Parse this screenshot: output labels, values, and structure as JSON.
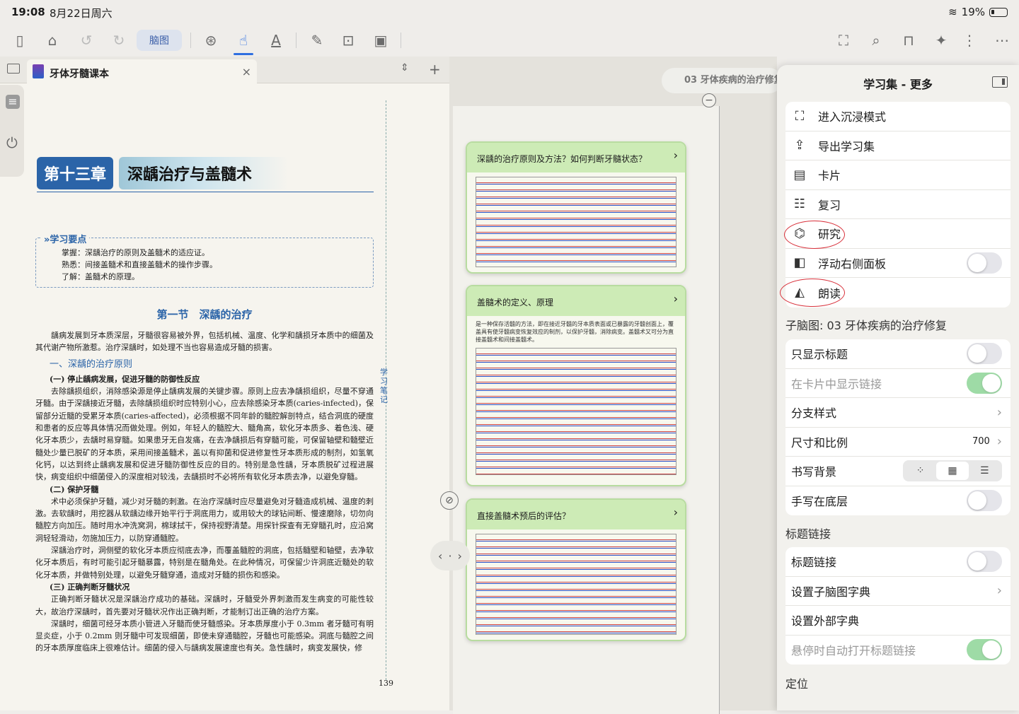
{
  "status": {
    "time": "19:08",
    "date": "8月22日周六",
    "battery": "19%"
  },
  "toolbar": {
    "mindmap_label": "脑图"
  },
  "left": {
    "tab_title": "牙体牙髓课本",
    "chapter_no": "第十三章",
    "chapter_title": "深龋治疗与盖髓术",
    "kp_title": "学习要点",
    "kp_lines": [
      "掌握：深龋治疗的原则及盖髓术的适应证。",
      "熟悉：间接盖髓术和直接盖髓术的操作步骤。",
      "了解：盖髓术的原理。"
    ],
    "section_title": "第一节　深龋的治疗",
    "intro": "龋病发展到牙本质深层，牙髓很容易被外界，包括机械、温度、化学和龋损牙本质中的细菌及其代谢产物所激惹。治疗深龋时，如处理不当也容易造成牙髓的损害。",
    "h1": "一、深龋的治疗原则",
    "h2a": "(一) 停止龋病发展，促进牙髓的防御性反应",
    "p1": "去除龋损组织，消除感染源是停止龋病发展的关键步骤。原则上应去净龋损组织，尽量不穿通牙髓。由于深龋接近牙髓，去除龋损组织时应特别小心，应去除感染牙本质(caries-infected)，保留部分近髓的受累牙本质(caries-affected)，必须根据不同年龄的髓腔解剖特点，结合洞底的硬度和患者的反应等具体情况而做处理。例如，年轻人的髓腔大、髓角高，软化牙本质多、着色浅、硬化牙本质少，去龋时易穿髓。如果患牙无自发痛，在去净龋损后有穿髓可能，可保留轴壁和髓壁近髓处少量已脱矿的牙本质，采用间接盖髓术，盖以有抑菌和促进修复性牙本质形成的制剂，如氢氧化钙，以达到终止龋病发展和促进牙髓防御性反应的目的。特别是急性龋，牙本质脱矿过程进展快，病变组织中细菌侵入的深度相对较浅，去龋损时不必将所有软化牙本质去净，以避免穿髓。",
    "h2b": "(二) 保护牙髓",
    "p2": "术中必须保护牙髓，减少对牙髓的刺激。在治疗深龋时应尽量避免对牙髓造成机械、温度的刺激。去软龋时，用挖器从软龋边缘开始平行于洞底用力，或用较大的球钻间断、慢速磨除，切勿向髓腔方向加压。随时用水冲洗窝洞，棉球拭干，保持视野清楚。用探针探查有无穿髓孔时，应沿窝洞轻轻滑动，勿施加压力，以防穿通髓腔。",
    "p3": "深龋治疗时，洞侧壁的软化牙本质应彻底去净，而覆盖髓腔的洞底，包括髓壁和轴壁，去净软化牙本质后，有时可能引起牙髓暴露，特别是在髓角处。在此种情况，可保留少许洞底近髓处的软化牙本质，并做特别处理，以避免牙髓穿通，造成对牙髓的损伤和感染。",
    "h2c": "(三) 正确判断牙髓状况",
    "p4": "正确判断牙髓状况是深龋治疗成功的基础。深龋时，牙髓受外界刺激而发生病变的可能性较大，故治疗深龋时，首先要对牙髓状况作出正确判断，才能制订出正确的治疗方案。",
    "p5": "深龋时，细菌可经牙本质小管进入牙髓而使牙髓感染。牙本质厚度小于 0.3mm 者牙髓可有明显炎症，小于 0.2mm 则牙髓中可发现细菌，即使未穿通髓腔，牙髓也可能感染。洞底与髓腔之间的牙本质厚度临床上很难估计。细菌的侵入与龋病发展速度也有关。急性龋时，病变发展快，修",
    "side_note": "学习笔记",
    "page_no": "139"
  },
  "mid": {
    "breadcrumb": "03 牙体疾病的治疗修复",
    "cards": [
      {
        "title": "深龋的治疗原则及方法？如何判断牙髓状态？"
      },
      {
        "title": "盖髓术的定义、原理",
        "text": "是一种保存活髓的方法，即在接近牙髓的牙本质表面或已暴露的牙髓创面上，覆盖具有使牙髓病变恢复效应的制剂，以保护牙髓，消除病变。盖髓术又可分为直接盖髓术和间接盖髓术。"
      },
      {
        "title": "直接盖髓术预后的评估？"
      }
    ]
  },
  "menu": {
    "title": "学习集 - 更多",
    "items": [
      "进入沉浸模式",
      "导出学习集",
      "卡片",
      "复习",
      "研究",
      "浮动右侧面板",
      "朗读"
    ],
    "sub_title": "子脑图: 03 牙体疾病的治疗修复",
    "settings": [
      "只显示标题",
      "在卡片中显示链接",
      "分支样式",
      "尺寸和比例",
      "书写背景",
      "手写在底层"
    ],
    "size_value": "700",
    "heading_links_section": "标题链接",
    "links": [
      "标题链接",
      "设置子脑图字典",
      "设置外部字典",
      "悬停时自动打开标题链接"
    ],
    "locate_section": "定位"
  }
}
